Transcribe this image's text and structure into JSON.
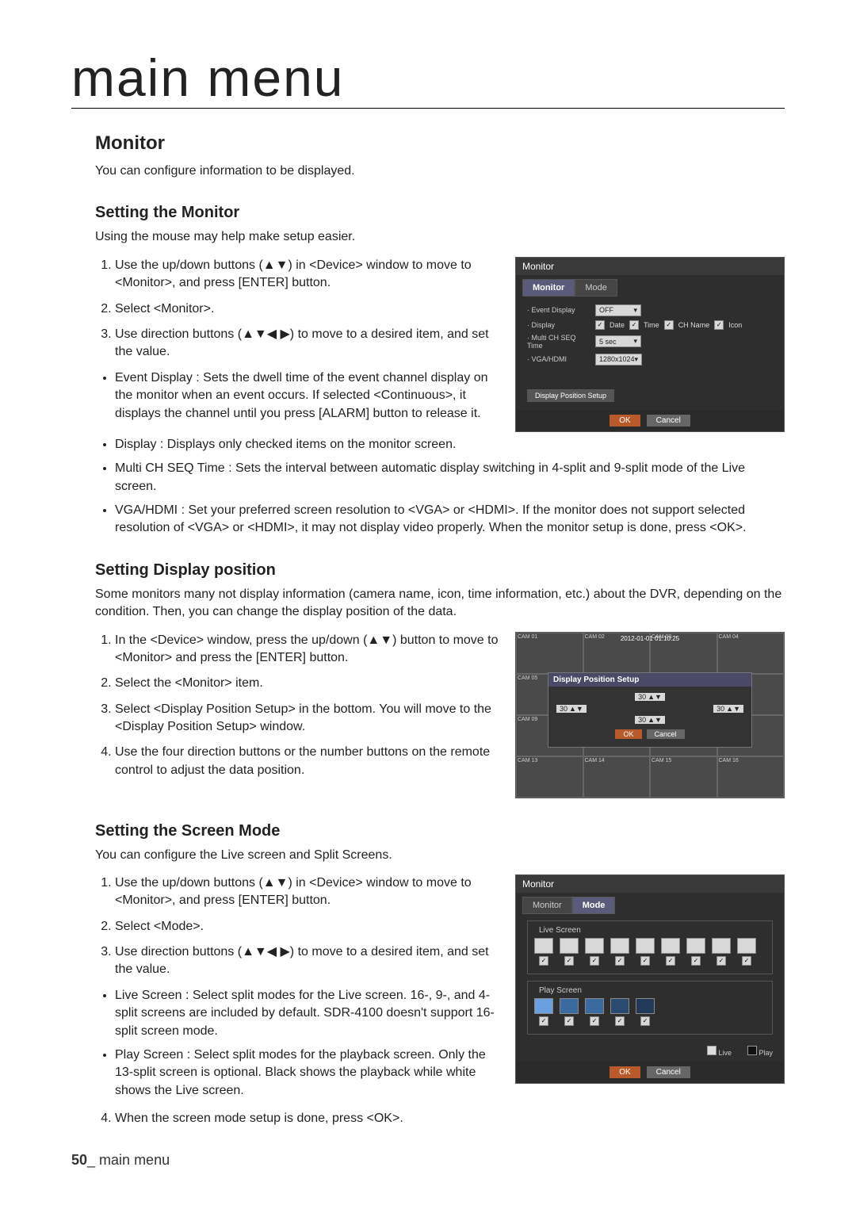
{
  "page": {
    "title": "main menu",
    "number": "50",
    "footer_label": "main menu"
  },
  "sections": {
    "monitor": {
      "heading": "Monitor",
      "intro": "You can configure information to be displayed."
    },
    "setting_monitor": {
      "heading": "Setting the Monitor",
      "hint": "Using the mouse may help make setup easier.",
      "steps": [
        "Use the up/down buttons (▲▼) in <Device> window to move to <Monitor>, and press [ENTER] button.",
        "Select <Monitor>.",
        "Use direction buttons (▲▼◀ ▶) to move to a desired item, and set the value."
      ],
      "bullets": [
        "Event Display : Sets the dwell time of the event channel display on the monitor when an event occurs. If selected <Continuous>, it displays the channel until you press [ALARM] button to release it.",
        "Display : Displays only checked items on the monitor screen.",
        "Multi CH SEQ Time : Sets the interval between automatic display switching in 4-split and 9-split mode of the Live screen.",
        "VGA/HDMI : Set your preferred screen resolution to <VGA> or <HDMI>. If the monitor does not support selected resolution of <VGA> or <HDMI>, it may not display video properly. When the monitor setup is done, press <OK>."
      ]
    },
    "setting_display_pos": {
      "heading": "Setting Display position",
      "intro": "Some monitors many not display information (camera name, icon, time information, etc.) about the DVR, depending on the condition. Then, you can change the display position of the data.",
      "steps": [
        "In the <Device> window, press the up/down (▲▼) button to move to <Monitor> and press the [ENTER] button.",
        "Select the <Monitor> item.",
        "Select <Display Position Setup> in the bottom. You will move to the <Display Position Setup> window.",
        "Use the four direction buttons or the number buttons on the remote control to adjust the data position."
      ]
    },
    "setting_screen_mode": {
      "heading": "Setting the Screen Mode",
      "intro": "You can configure the Live screen and Split Screens.",
      "steps": [
        "Use the up/down buttons (▲▼) in <Device> window to move to <Monitor>, and press [ENTER] button.",
        "Select <Mode>.",
        "Use direction buttons (▲▼◀ ▶) to move to a desired item, and set the value."
      ],
      "bullets": [
        "Live Screen : Select split modes for the Live screen. 16-, 9-, and 4-split screens are included by default. SDR-4100 doesn't support 16-split screen mode.",
        "Play Screen : Select split modes for the playback screen. Only the 13-split screen is optional. Black shows the playback while white shows the Live screen."
      ],
      "last": "When the screen mode setup is done, press <OK>."
    }
  },
  "screenshot1": {
    "title": "Monitor",
    "tab_active": "Monitor",
    "tab_other": "Mode",
    "rows": {
      "event_display_label": "· Event Display",
      "event_display_value": "OFF",
      "display_label": "· Display",
      "checks": [
        "Date",
        "Time",
        "CH Name",
        "Icon"
      ],
      "multi_label": "· Multi CH SEQ Time",
      "multi_value": "5 sec",
      "vga_label": "· VGA/HDMI",
      "vga_value": "1280x1024"
    },
    "link_btn": "Display Position Setup",
    "ok": "OK",
    "cancel": "Cancel"
  },
  "screenshot2": {
    "timestamp": "2012-01-01 01:10:25",
    "title": "Display Position Setup",
    "value": "30",
    "ok": "OK",
    "cancel": "Cancel",
    "cams": [
      "CAM 01",
      "CAM 02",
      "CAM 03",
      "CAM 04",
      "CAM 05",
      "",
      "",
      "",
      "CAM 09",
      "",
      "",
      "",
      "CAM 13",
      "CAM 14",
      "CAM 15",
      "CAM 16"
    ]
  },
  "screenshot3": {
    "title": "Monitor",
    "tab_other": "Monitor",
    "tab_active": "Mode",
    "group1": "Live Screen",
    "group2": "Play Screen",
    "legend_live": "Live",
    "legend_play": "Play",
    "ok": "OK",
    "cancel": "Cancel"
  }
}
